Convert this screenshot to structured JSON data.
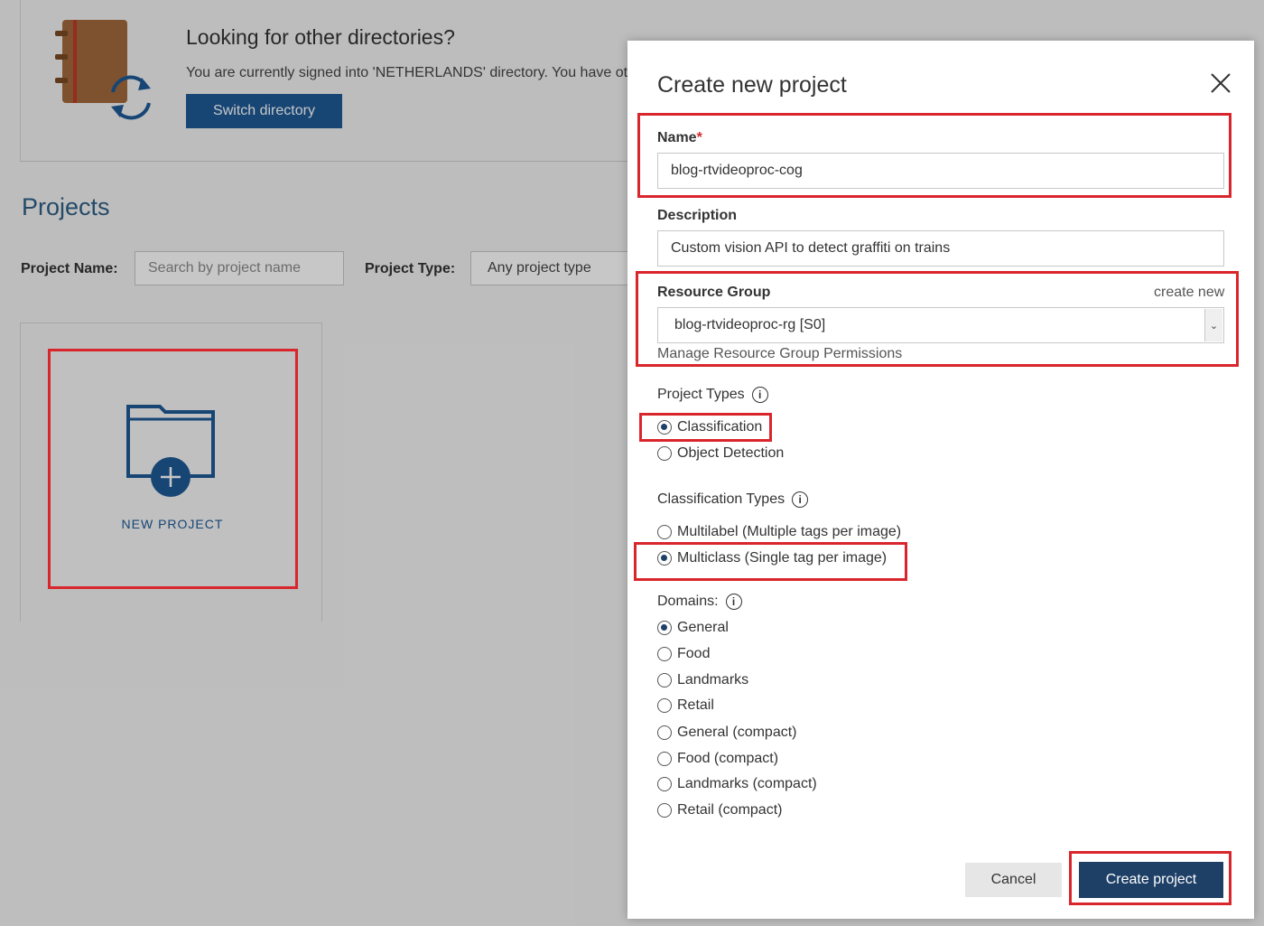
{
  "background": {
    "banner": {
      "title": "Looking for other directories?",
      "text": "You are currently signed into 'NETHERLANDS' directory. You have oth",
      "switch_label": "Switch directory"
    },
    "projects_heading": "Projects",
    "filters": {
      "name_label": "Project Name:",
      "name_placeholder": "Search by project name",
      "type_label": "Project Type:",
      "type_value": "Any project type"
    },
    "new_project_label": "NEW PROJECT"
  },
  "modal": {
    "title": "Create new project",
    "name": {
      "label": "Name",
      "required_mark": "*",
      "value": "blog-rtvideoproc-cog"
    },
    "description": {
      "label": "Description",
      "value": "Custom vision API to detect graffiti on trains"
    },
    "resource_group": {
      "label": "Resource Group",
      "create_new": "create new",
      "selected": "blog-rtvideoproc-rg [S0]",
      "manage_link": "Manage Resource Group Permissions"
    },
    "project_types": {
      "label": "Project Types",
      "options": [
        {
          "label": "Classification",
          "checked": true
        },
        {
          "label": "Object Detection",
          "checked": false
        }
      ]
    },
    "classification_types": {
      "label": "Classification Types",
      "options": [
        {
          "label": "Multilabel (Multiple tags per image)",
          "checked": false
        },
        {
          "label": "Multiclass (Single tag per image)",
          "checked": true
        }
      ]
    },
    "domains": {
      "label": "Domains:",
      "options": [
        {
          "label": "General",
          "checked": true
        },
        {
          "label": "Food",
          "checked": false
        },
        {
          "label": "Landmarks",
          "checked": false
        },
        {
          "label": "Retail",
          "checked": false
        },
        {
          "label": "General (compact)",
          "checked": false
        },
        {
          "label": "Food (compact)",
          "checked": false
        },
        {
          "label": "Landmarks (compact)",
          "checked": false
        },
        {
          "label": "Retail (compact)",
          "checked": false
        }
      ]
    },
    "cancel_label": "Cancel",
    "create_label": "Create project"
  },
  "colors": {
    "accent": "#1e3f66",
    "switch_button": "#1e5a96",
    "highlight": "#d9262c"
  }
}
